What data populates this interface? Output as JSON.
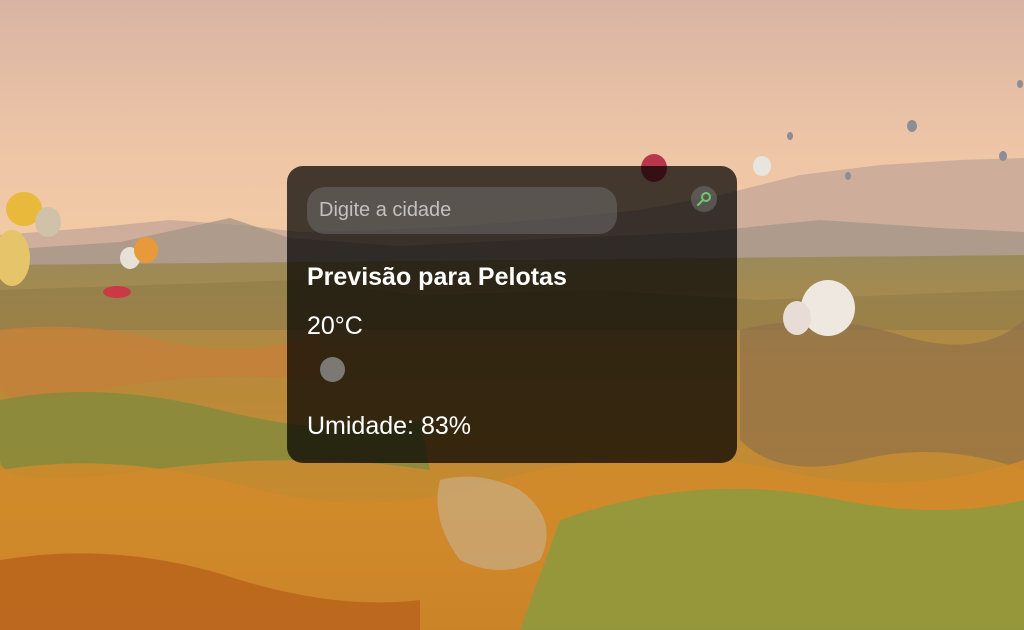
{
  "search": {
    "placeholder": "Digite a cidade",
    "value": ""
  },
  "weather": {
    "title": "Previsão para Pelotas",
    "temperature": "20°C",
    "humidity": "Umidade: 83%"
  },
  "icons": {
    "search_button": "search-icon",
    "weather": "weather-icon"
  },
  "colors": {
    "card_background": "#000000b8",
    "search_icon": "#6fc96f"
  }
}
